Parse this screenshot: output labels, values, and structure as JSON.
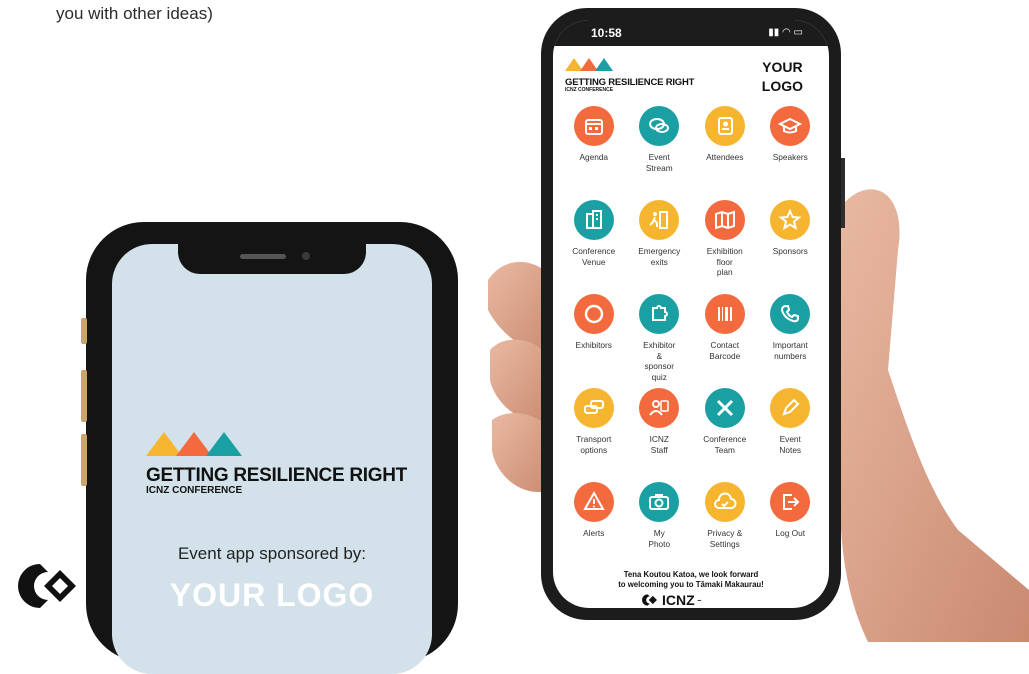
{
  "top_note": "you with other ideas)",
  "left_phone": {
    "brand_title": "GETTING RESILIENCE RIGHT",
    "brand_subtitle": "ICNZ CONFERENCE",
    "sponsored_text": "Event app sponsored by:",
    "your_logo": "YOUR LOGO"
  },
  "right_phone": {
    "time": "10:58",
    "brand_title": "GETTING RESILIENCE RIGHT",
    "brand_subtitle": "ICNZ CONFERENCE",
    "logo_line1": "YOUR",
    "logo_line2": "LOGO",
    "tiles": [
      {
        "label": "Agenda",
        "icon": "calendar-icon",
        "color": "#f26a3d"
      },
      {
        "label": "Event\nStream",
        "icon": "chat-icon",
        "color": "#1a9fa3"
      },
      {
        "label": "Attendees",
        "icon": "contacts-icon",
        "color": "#f6b52e"
      },
      {
        "label": "Speakers",
        "icon": "graduation-cap-icon",
        "color": "#f26a3d"
      },
      {
        "label": "Conference\nVenue",
        "icon": "building-icon",
        "color": "#1a9fa3"
      },
      {
        "label": "Emergency\nexits",
        "icon": "exit-icon",
        "color": "#f6b52e"
      },
      {
        "label": "Exhibition\nfloor\nplan",
        "icon": "map-icon",
        "color": "#f26a3d"
      },
      {
        "label": "Sponsors",
        "icon": "star-icon",
        "color": "#f6b52e"
      },
      {
        "label": "Exhibitors",
        "icon": "circle-icon",
        "color": "#f26a3d"
      },
      {
        "label": "Exhibitor\n&\nsponsor\nquiz",
        "icon": "puzzle-icon",
        "color": "#1a9fa3"
      },
      {
        "label": "Contact\nBarcode",
        "icon": "barcode-icon",
        "color": "#f26a3d"
      },
      {
        "label": "Important\nnumbers",
        "icon": "phone-icon",
        "color": "#1a9fa3"
      },
      {
        "label": "Transport\noptions",
        "icon": "car-icon",
        "color": "#f6b52e"
      },
      {
        "label": "ICNZ\nStaff",
        "icon": "people-icon",
        "color": "#f26a3d"
      },
      {
        "label": "Conference\nTeam",
        "icon": "team-icon",
        "color": "#1a9fa3"
      },
      {
        "label": "Event\nNotes",
        "icon": "pen-icon",
        "color": "#f6b52e"
      },
      {
        "label": "Alerts",
        "icon": "alert-icon",
        "color": "#f26a3d"
      },
      {
        "label": "My\nPhoto",
        "icon": "camera-icon",
        "color": "#1a9fa3"
      },
      {
        "label": "Privacy &\nSettings",
        "icon": "cloud-check-icon",
        "color": "#f6b52e"
      },
      {
        "label": "Log Out",
        "icon": "logout-icon",
        "color": "#f26a3d"
      }
    ],
    "footer_line1": "Tena Koutou Katoa, we look forward",
    "footer_line2": "to welcoming you to Tāmaki Makaurau!",
    "footer_logo_text": "ICNZ"
  },
  "colors": {
    "orange": "#f26a3d",
    "teal": "#1a9fa3",
    "yellow": "#f6b52e"
  }
}
